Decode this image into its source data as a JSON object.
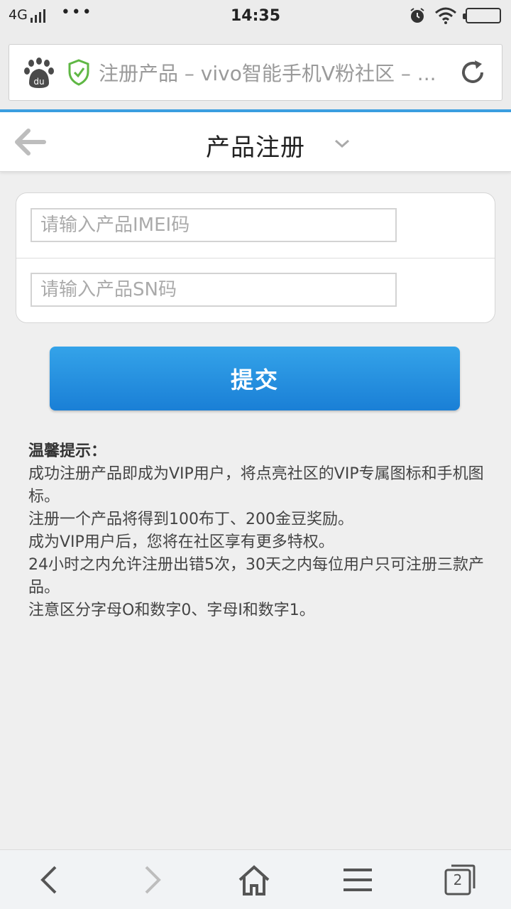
{
  "status_bar": {
    "network": "4G",
    "dots": "•••",
    "time": "14:35"
  },
  "browser": {
    "page_title": "注册产品 – vivo智能手机V粉社区 – ..."
  },
  "header": {
    "title": "产品注册"
  },
  "form": {
    "imei_placeholder": "请输入产品IMEI码",
    "sn_placeholder": "请输入产品SN码",
    "imei_value": "",
    "sn_value": "",
    "submit_label": "提交"
  },
  "tips": {
    "title": "温馨提示：",
    "lines": [
      "成功注册产品即成为VIP用户，将点亮社区的VIP专属图标和手机图标。",
      "注册一个产品将得到100布丁、200金豆奖励。",
      "成为VIP用户后，您将在社区享有更多特权。",
      "24小时之内允许注册出错5次，30天之内每位用户只可注册三款产品。",
      "注意区分字母O和数字0、字母I和数字1。"
    ]
  },
  "bottom_nav": {
    "tab_count": "2"
  },
  "colors": {
    "accent": "#1a7fd6",
    "accent_light": "#34a3e9",
    "shield": "#5fb744",
    "top_line": "#3b9ee0"
  }
}
